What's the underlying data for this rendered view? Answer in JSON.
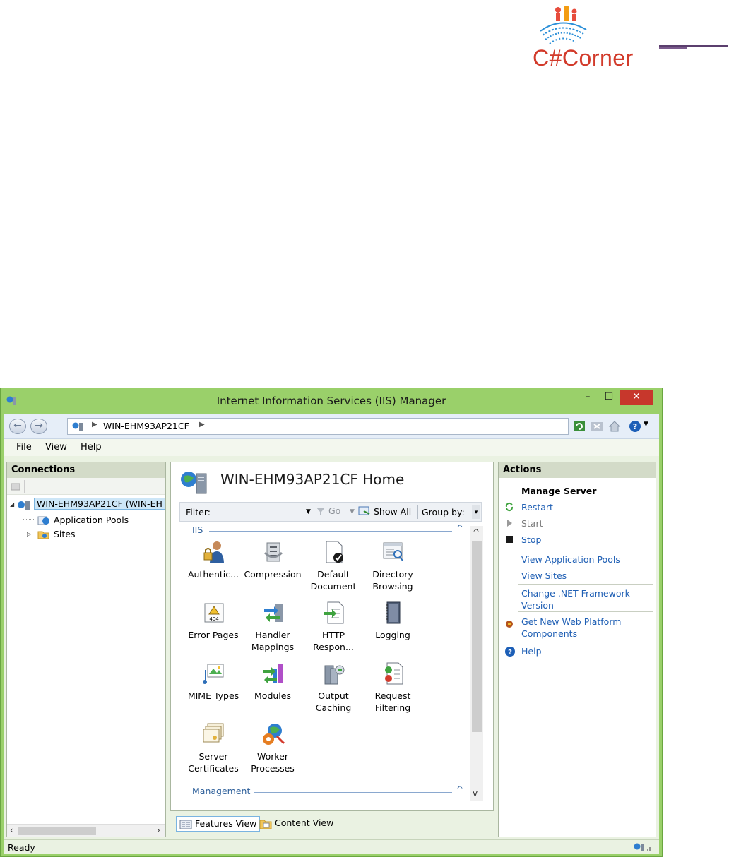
{
  "logo": {
    "text": "C#Corner"
  },
  "window": {
    "title": "Internet Information Services (IIS) Manager"
  },
  "address": {
    "path": "WIN-EHM93AP21CF"
  },
  "menu": {
    "file": "File",
    "view": "View",
    "help": "Help"
  },
  "connections": {
    "header": "Connections",
    "tree": [
      {
        "label": "WIN-EHM93AP21CF (WIN-EH"
      },
      {
        "label": "Application Pools"
      },
      {
        "label": "Sites"
      }
    ]
  },
  "center": {
    "title": "WIN-EHM93AP21CF Home",
    "filter_label": "Filter:",
    "go_label": "Go",
    "show_all_label": "Show All",
    "group_by_label": "Group by:",
    "group_iis": "IIS",
    "group_management": "Management",
    "features": [
      {
        "line1": "Authentic...",
        "line2": ""
      },
      {
        "line1": "Compression",
        "line2": ""
      },
      {
        "line1": "Default",
        "line2": "Document"
      },
      {
        "line1": "Directory",
        "line2": "Browsing"
      },
      {
        "line1": "Error Pages",
        "line2": ""
      },
      {
        "line1": "Handler",
        "line2": "Mappings"
      },
      {
        "line1": "HTTP",
        "line2": "Respon..."
      },
      {
        "line1": "Logging",
        "line2": ""
      },
      {
        "line1": "MIME Types",
        "line2": ""
      },
      {
        "line1": "Modules",
        "line2": ""
      },
      {
        "line1": "Output",
        "line2": "Caching"
      },
      {
        "line1": "Request",
        "line2": "Filtering"
      },
      {
        "line1": "Server",
        "line2": "Certificates"
      },
      {
        "line1": "Worker",
        "line2": "Processes"
      }
    ],
    "error_badge": "404"
  },
  "views": {
    "features": "Features View",
    "content": "Content View"
  },
  "actions": {
    "header": "Actions",
    "section_title": "Manage Server",
    "restart": "Restart",
    "start": "Start",
    "stop": "Stop",
    "view_app_pools": "View Application Pools",
    "view_sites": "View Sites",
    "change_net_1": "Change .NET Framework",
    "change_net_2": "Version",
    "get_wpi_1": "Get New Web Platform",
    "get_wpi_2": "Components",
    "help": "Help"
  },
  "status": {
    "text": "Ready"
  },
  "colors": {
    "title_bar": "#9ad06a",
    "close_button": "#c7372c",
    "link": "#1f5fb4",
    "group_header": "#2d5f9a",
    "logo_text": "#d23b2b"
  }
}
